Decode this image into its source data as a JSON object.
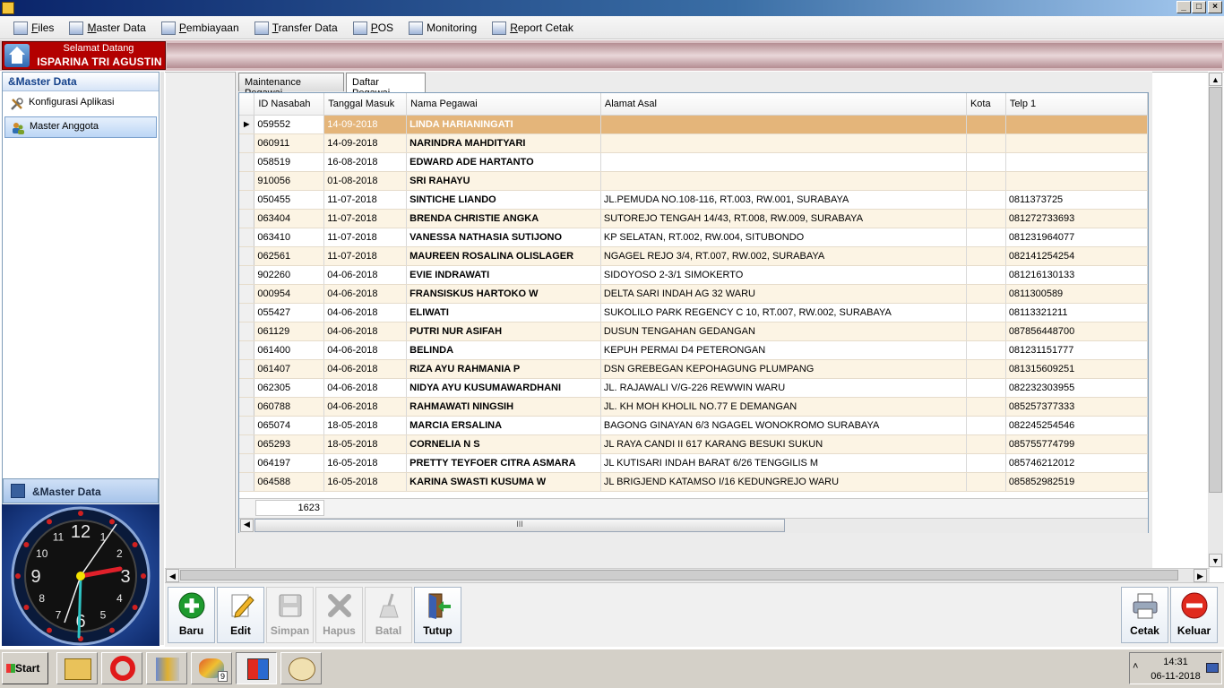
{
  "menu": [
    "Files",
    "Master Data",
    "Pembiayaan",
    "Transfer Data",
    "POS",
    "Monitoring",
    "Report Cetak"
  ],
  "welcome": {
    "greeting": "Selamat Datang",
    "user_name": "ISPARINA TRI AGUSTIN"
  },
  "sidebar": {
    "header": "&Master Data",
    "items": [
      "Konfigurasi Aplikasi",
      "Master Anggota"
    ],
    "footer": "&Master Data"
  },
  "tabs": [
    "Maintenance Pegawai",
    "Daftar Pegawai"
  ],
  "grid": {
    "columns": [
      "ID Nasabah",
      "Tanggal Masuk",
      "Nama Pegawai",
      "Alamat Asal",
      "Kota",
      "Telp 1"
    ],
    "rows": [
      [
        "059552",
        "14-09-2018",
        "LINDA HARIANINGATI",
        "",
        "",
        ""
      ],
      [
        "060911",
        "14-09-2018",
        "NARINDRA MAHDITYARI",
        "",
        "",
        ""
      ],
      [
        "058519",
        "16-08-2018",
        "EDWARD ADE HARTANTO",
        "",
        "",
        ""
      ],
      [
        "910056",
        "01-08-2018",
        "SRI RAHAYU",
        "",
        "",
        ""
      ],
      [
        "050455",
        "11-07-2018",
        "SINTICHE LIANDO",
        "JL.PEMUDA NO.108-116, RT.003, RW.001, SURABAYA",
        "",
        "0811373725"
      ],
      [
        "063404",
        "11-07-2018",
        "BRENDA CHRISTIE ANGKA",
        "SUTOREJO TENGAH 14/43, RT.008, RW.009, SURABAYA",
        "",
        "081272733693"
      ],
      [
        "063410",
        "11-07-2018",
        "VANESSA NATHASIA SUTIJONO",
        "KP SELATAN, RT.002, RW.004, SITUBONDO",
        "",
        "081231964077"
      ],
      [
        "062561",
        "11-07-2018",
        "MAUREEN ROSALINA OLISLAGER",
        "NGAGEL REJO 3/4, RT.007, RW.002, SURABAYA",
        "",
        "082141254254"
      ],
      [
        "902260",
        "04-06-2018",
        "EVIE INDRAWATI",
        "SIDOYOSO 2-3/1 SIMOKERTO",
        "",
        "081216130133"
      ],
      [
        "000954",
        "04-06-2018",
        "FRANSISKUS HARTOKO W",
        "DELTA SARI INDAH AG 32 WARU",
        "",
        "0811300589"
      ],
      [
        "055427",
        "04-06-2018",
        "ELIWATI",
        "SUKOLILO PARK REGENCY C 10, RT.007, RW.002, SURABAYA",
        "",
        "08113321211"
      ],
      [
        "061129",
        "04-06-2018",
        "PUTRI NUR ASIFAH",
        "DUSUN TENGAHAN GEDANGAN",
        "",
        "087856448700"
      ],
      [
        "061400",
        "04-06-2018",
        "BELINDA",
        "KEPUH PERMAI D4 PETERONGAN",
        "",
        "081231151777"
      ],
      [
        "061407",
        "04-06-2018",
        "RIZA AYU RAHMANIA P",
        "DSN GREBEGAN KEPOHAGUNG PLUMPANG",
        "",
        "081315609251"
      ],
      [
        "062305",
        "04-06-2018",
        "NIDYA AYU KUSUMAWARDHANI",
        "JL. RAJAWALI V/G-226 REWWIN WARU",
        "",
        "082232303955"
      ],
      [
        "060788",
        "04-06-2018",
        "RAHMAWATI NINGSIH",
        "JL. KH MOH KHOLIL NO.77 E DEMANGAN",
        "",
        "085257377333"
      ],
      [
        "065074",
        "18-05-2018",
        "MARCIA ERSALINA",
        "BAGONG GINAYAN 6/3 NGAGEL WONOKROMO SURABAYA",
        "",
        "082245254546"
      ],
      [
        "065293",
        "18-05-2018",
        "CORNELIA N S",
        "JL RAYA CANDI II 617 KARANG BESUKI SUKUN",
        "",
        "085755774799"
      ],
      [
        "064197",
        "16-05-2018",
        "PRETTY TEYFOER CITRA ASMARA",
        "JL KUTISARI INDAH BARAT 6/26 TENGGILIS M",
        "",
        "085746212012"
      ],
      [
        "064588",
        "16-05-2018",
        "KARINA SWASTI KUSUMA W",
        "JL BRIGJEND KATAMSO I/16 KEDUNGREJO WARU",
        "",
        "085852982519"
      ]
    ],
    "selected_row": 0,
    "total_count": "1623",
    "scroll_glyph": "III"
  },
  "toolbar": {
    "buttons": [
      {
        "label": "Baru",
        "enabled": true
      },
      {
        "label": "Edit",
        "enabled": true
      },
      {
        "label": "Simpan",
        "enabled": false
      },
      {
        "label": "Hapus",
        "enabled": false
      },
      {
        "label": "Batal",
        "enabled": false
      },
      {
        "label": "Tutup",
        "enabled": true
      }
    ],
    "right_buttons": [
      {
        "label": "Cetak",
        "enabled": true
      },
      {
        "label": "Keluar",
        "enabled": true
      }
    ]
  },
  "clock": {
    "hour_numbers": [
      "12",
      "1",
      "2",
      "3",
      "4",
      "5",
      "6",
      "7",
      "8",
      "9",
      "10",
      "11"
    ]
  },
  "taskbar": {
    "start_label": "Start",
    "time": "14:31",
    "date": "06-11-2018",
    "badge": "9"
  }
}
